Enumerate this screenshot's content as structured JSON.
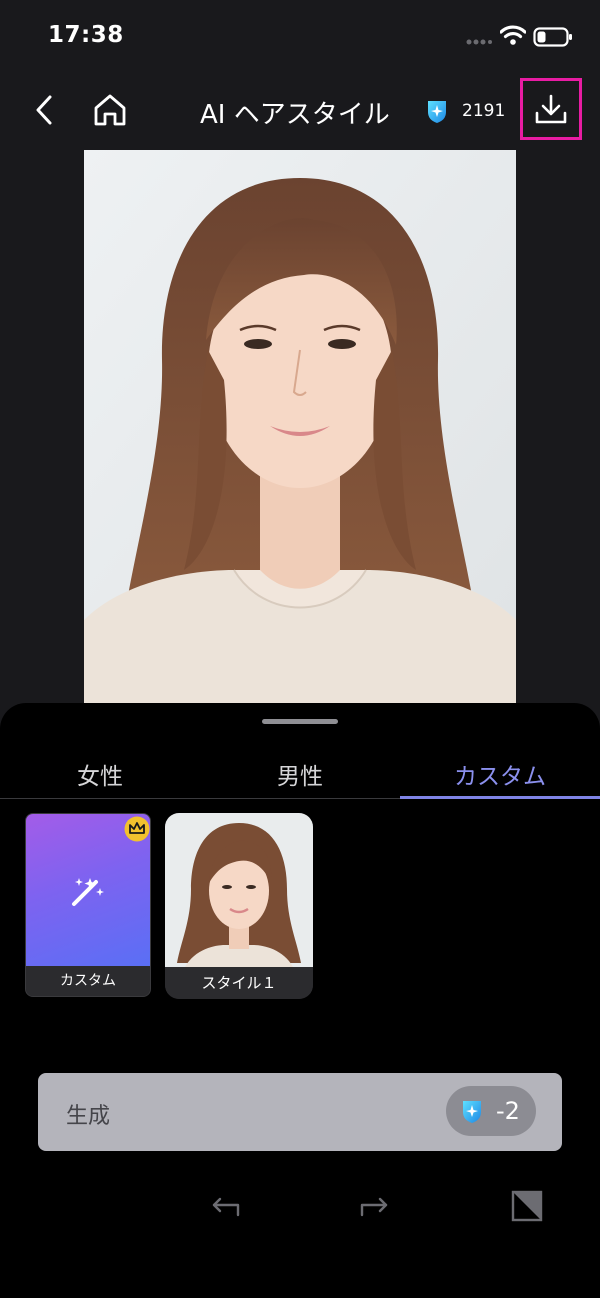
{
  "status_bar": {
    "time": "17:38",
    "icons": [
      "signal-icon",
      "wifi-icon",
      "battery-icon"
    ]
  },
  "header": {
    "title": "AI ヘアスタイル",
    "credits": "2191",
    "icons": [
      "back-icon",
      "home-icon",
      "credit-icon",
      "download-icon"
    ],
    "highlight_color": "#e81ca3"
  },
  "photo": {
    "subject": "portrait-photo"
  },
  "tabs": [
    {
      "label": "女性",
      "active": false
    },
    {
      "label": "男性",
      "active": false
    },
    {
      "label": "カスタム",
      "active": true
    }
  ],
  "styles": [
    {
      "label": "カスタム",
      "icon": "magic-wand-icon",
      "badge": "crown-icon"
    },
    {
      "label": "スタイル１",
      "icon": "hairstyle-thumbnail"
    }
  ],
  "generate": {
    "label": "生成",
    "cost": "-2",
    "icon": "credit-icon"
  },
  "toolbar": {
    "icons": [
      "undo-icon",
      "redo-icon",
      "compare-icon"
    ]
  },
  "colors": {
    "accent": "#8b90ee",
    "credit_blue": "#29b6f6"
  }
}
